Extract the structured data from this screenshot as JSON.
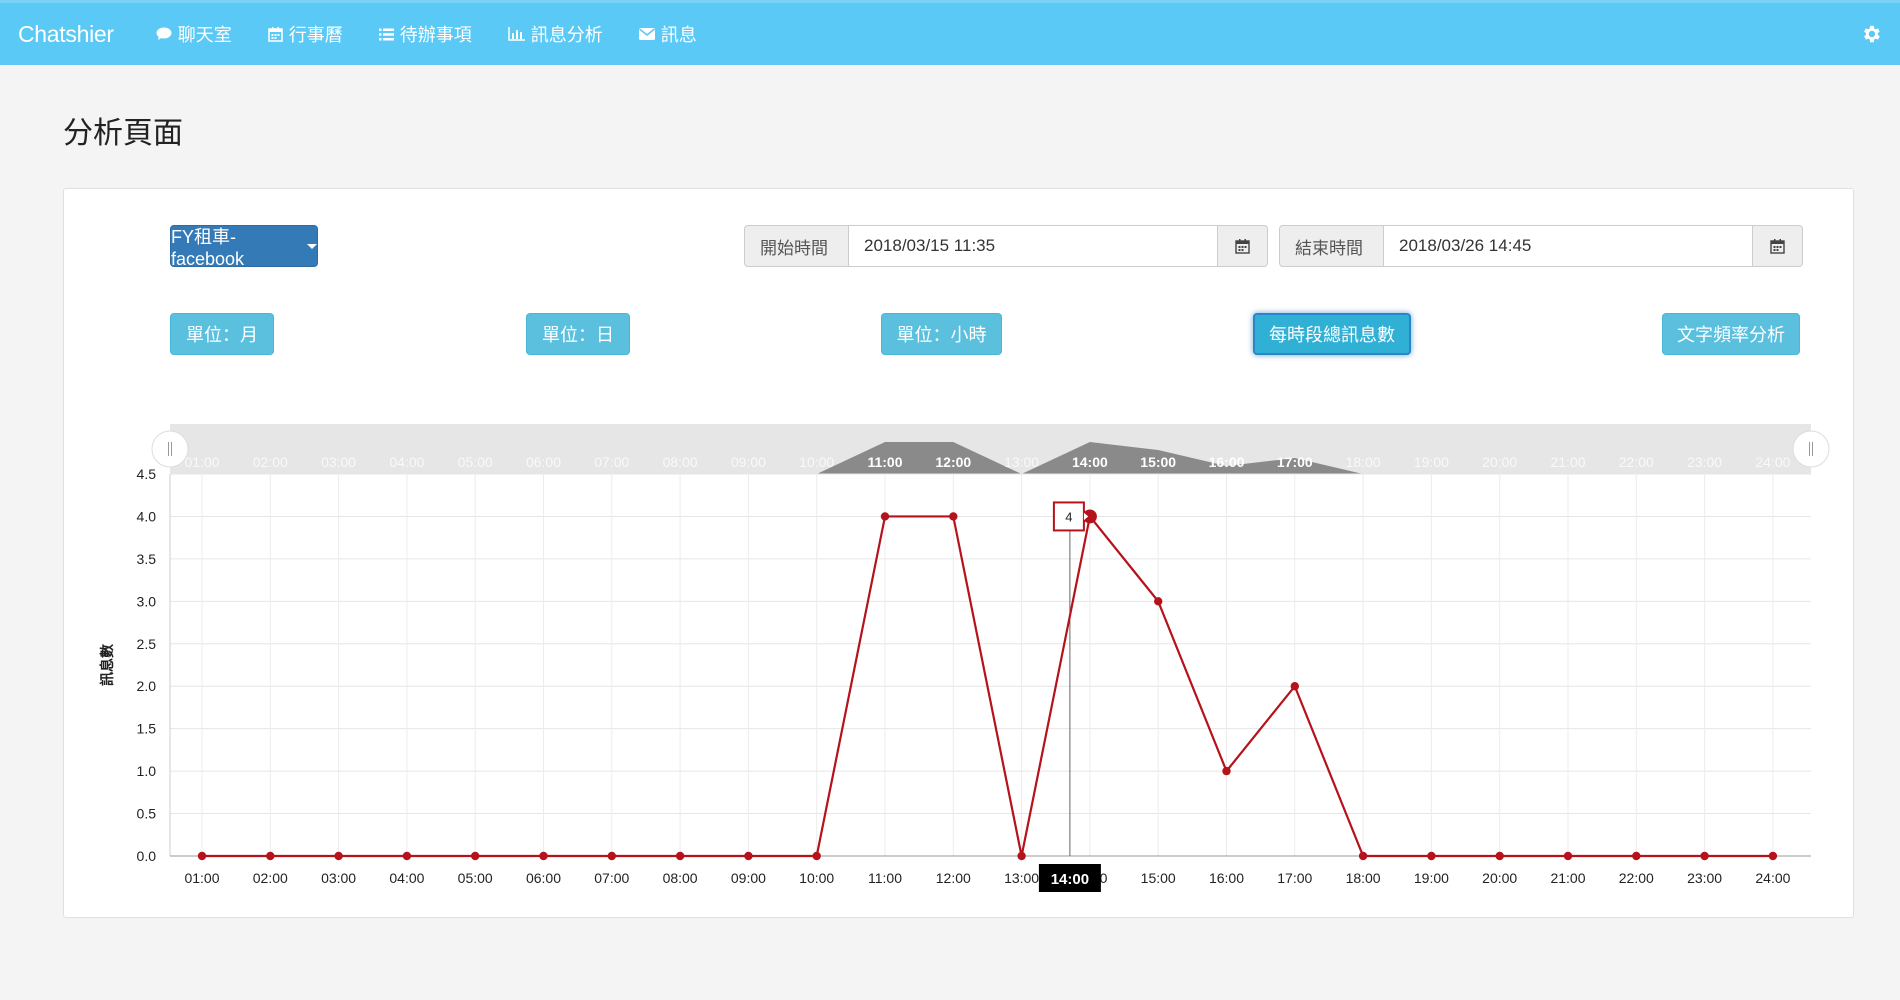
{
  "topbar": {
    "brand": "Chatshier",
    "items": [
      {
        "label": "聊天室",
        "icon": "comment-icon"
      },
      {
        "label": "行事曆",
        "icon": "calendar-icon"
      },
      {
        "label": "待辦事項",
        "icon": "list-icon"
      },
      {
        "label": "訊息分析",
        "icon": "bar-chart-icon"
      },
      {
        "label": "訊息",
        "icon": "envelope-icon"
      }
    ],
    "settings_icon": "gear-icon",
    "color": "#5bc9f6"
  },
  "page": {
    "title": "分析頁面"
  },
  "controls": {
    "app_select": "FY租車-facebook",
    "start": {
      "label": "開始時間",
      "value": "2018/03/15 11:35"
    },
    "end": {
      "label": "結束時間",
      "value": "2018/03/26 14:45"
    },
    "buttons": [
      {
        "label": "單位：月",
        "active": false
      },
      {
        "label": "單位：日",
        "active": false
      },
      {
        "label": "單位：小時",
        "active": false
      },
      {
        "label": "每時段總訊息數",
        "active": true
      },
      {
        "label": "文字頻率分析",
        "active": false
      }
    ]
  },
  "chart_data": {
    "type": "line",
    "ylabel": "訊息數",
    "xlabel": "",
    "ylim": [
      0,
      4.5
    ],
    "yticks": [
      "0.0",
      "0.5",
      "1.0",
      "1.5",
      "2.0",
      "2.5",
      "3.0",
      "3.5",
      "4.0",
      "4.5"
    ],
    "categories": [
      "01:00",
      "02:00",
      "03:00",
      "04:00",
      "05:00",
      "06:00",
      "07:00",
      "08:00",
      "09:00",
      "10:00",
      "11:00",
      "12:00",
      "13:00",
      "14:00",
      "15:00",
      "16:00",
      "17:00",
      "18:00",
      "19:00",
      "20:00",
      "21:00",
      "22:00",
      "23:00",
      "24:00"
    ],
    "series": [
      {
        "values": [
          0,
          0,
          0,
          0,
          0,
          0,
          0,
          0,
          0,
          0,
          4,
          4,
          0,
          4,
          3,
          1,
          2,
          0,
          0,
          0,
          0,
          0,
          0,
          0
        ],
        "color": "#b5121b"
      }
    ],
    "grid": true,
    "navigator": true,
    "tooltip": {
      "category": "14:00",
      "value": "4"
    }
  }
}
